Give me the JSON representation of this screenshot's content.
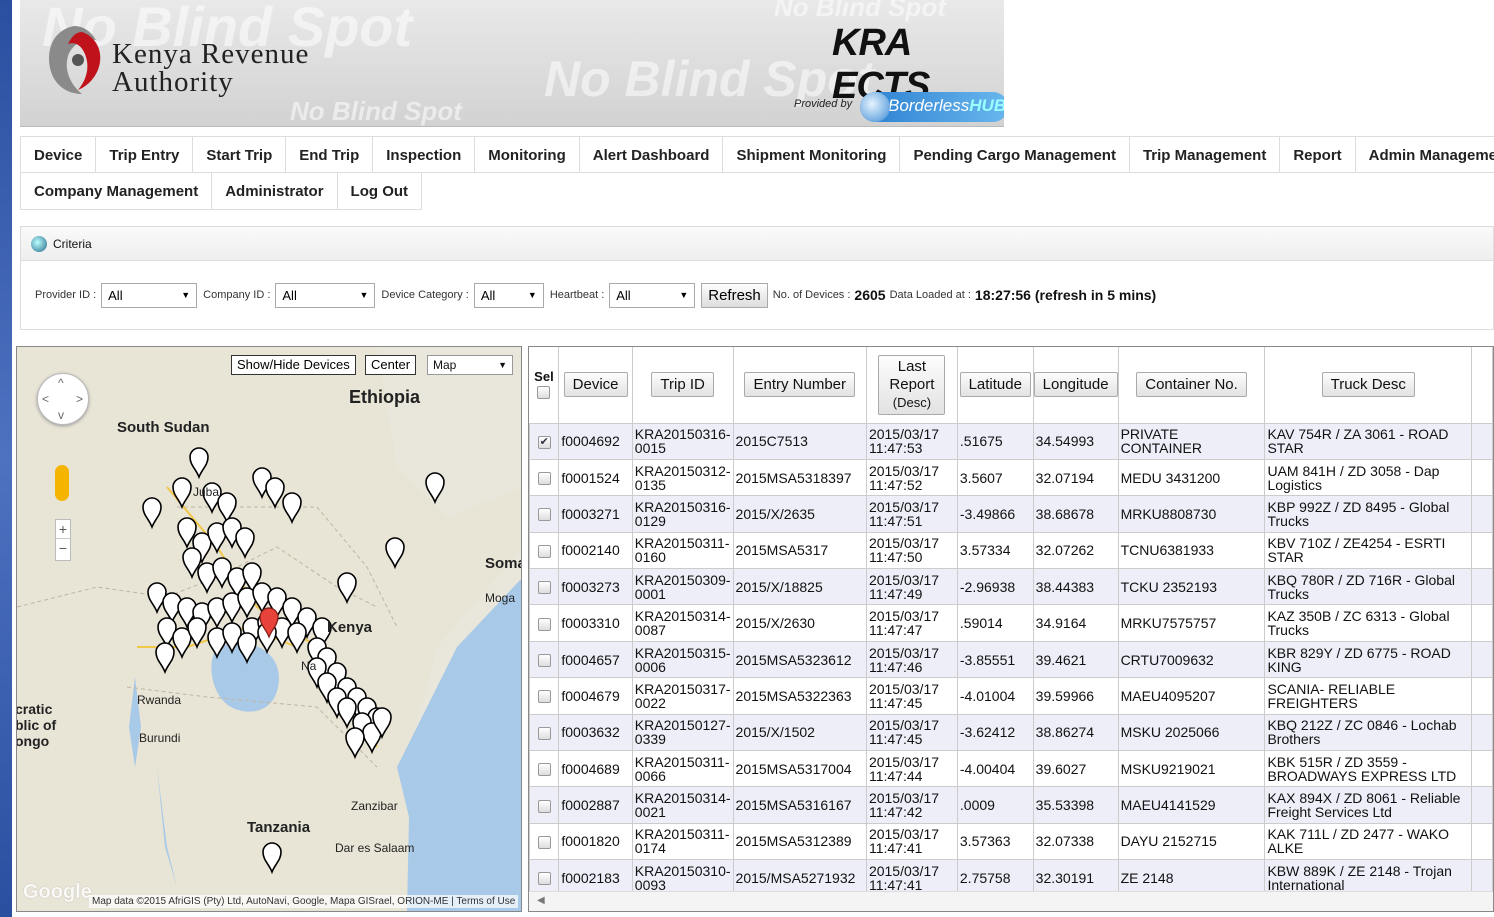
{
  "banner": {
    "brand_line1": "Kenya Revenue",
    "brand_line2": "Authority",
    "ghost_text": "No Blind Spot",
    "app_name": "KRA ECTS",
    "provided_by": "Provided by",
    "partner_name_a": "Borderless",
    "partner_name_b": "HUB"
  },
  "nav": {
    "row1": [
      "Device",
      "Trip Entry",
      "Start Trip",
      "End Trip",
      "Inspection",
      "Monitoring",
      "Alert Dashboard",
      "Shipment Monitoring",
      "Pending Cargo Management",
      "Trip Management",
      "Report",
      "Admin Management"
    ],
    "row2": [
      "Company Management",
      "Administrator",
      "Log Out"
    ]
  },
  "criteria": {
    "title": "Criteria",
    "provider_label": "Provider ID :",
    "provider_value": "All",
    "company_label": "Company ID :",
    "company_value": "All",
    "category_label": "Device Category :",
    "category_value": "All",
    "heartbeat_label": "Heartbeat :",
    "heartbeat_value": "All",
    "refresh_label": "Refresh",
    "devices_label": "No. of Devices :",
    "devices_count": "2605",
    "loaded_label": "Data Loaded at :",
    "loaded_value": "18:27:56 (refresh in 5 mins)"
  },
  "map": {
    "show_hide_label": "Show/Hide Devices",
    "center_label": "Center",
    "type_value": "Map",
    "labels": {
      "ethiopia": "Ethiopia",
      "south_sudan": "South Sudan",
      "juba": "Juba",
      "somalia": "Soma",
      "mogadishu": "Moga",
      "kenya": "Kenya",
      "nairobi": "Na",
      "rwanda": "Rwanda",
      "burundi": "Burundi",
      "drc1": "cratic",
      "drc2": "blic of",
      "drc3": "ongo",
      "tanzania": "Tanzania",
      "zanzibar": "Zanzibar",
      "dar": "Dar es Salaam",
      "google": "Google"
    },
    "attribution": "Map data ©2015 AfriGIS (Pty) Ltd, AutoNavi, Google, Mapa GISrael, ORION-ME",
    "terms": "Terms of Use"
  },
  "grid": {
    "headers": {
      "sel": "Sel",
      "device": "Device",
      "trip_id": "Trip ID",
      "entry": "Entry Number",
      "last_report1": "Last",
      "last_report2": "Report",
      "last_report_sort": "(Desc)",
      "lat": "Latitude",
      "lon": "Longitude",
      "container": "Container No.",
      "truck": "Truck Desc"
    },
    "rows": [
      {
        "checked": true,
        "device": "f0004692",
        "trip1": "KRA20150316-",
        "trip2": "0015",
        "entry": "2015C7513",
        "date": "2015/03/17",
        "time": "11:47:53",
        "lat": ".51675",
        "lon": "34.54993",
        "container": "PRIVATE CONTAINER",
        "truck": "KAV 754R / ZA 3061 - ROAD STAR"
      },
      {
        "checked": false,
        "device": "f0001524",
        "trip1": "KRA20150312-",
        "trip2": "0135",
        "entry": "2015MSA5318397",
        "date": "2015/03/17",
        "time": "11:47:52",
        "lat": "3.5607",
        "lon": "32.07194",
        "container": "MEDU 3431200",
        "truck": "UAM 841H / ZD 3058 - Dap Logistics"
      },
      {
        "checked": false,
        "device": "f0003271",
        "trip1": "KRA20150316-",
        "trip2": "0129",
        "entry": "2015/X/2635",
        "date": "2015/03/17",
        "time": "11:47:51",
        "lat": "-3.49866",
        "lon": "38.68678",
        "container": "MRKU8808730",
        "truck": "KBP 992Z / ZD 8495 - Global Trucks"
      },
      {
        "checked": false,
        "device": "f0002140",
        "trip1": "KRA20150311-",
        "trip2": "0160",
        "entry": "2015MSA5317",
        "date": "2015/03/17",
        "time": "11:47:50",
        "lat": "3.57334",
        "lon": "32.07262",
        "container": "TCNU6381933",
        "truck": "KBV 710Z / ZE4254 - ESRTI STAR"
      },
      {
        "checked": false,
        "device": "f0003273",
        "trip1": "KRA20150309-",
        "trip2": "0001",
        "entry": "2015/X/18825",
        "date": "2015/03/17",
        "time": "11:47:49",
        "lat": "-2.96938",
        "lon": "38.44383",
        "container": "TCKU 2352193",
        "truck": "KBQ 780R / ZD 716R - Global Trucks"
      },
      {
        "checked": false,
        "device": "f0003310",
        "trip1": "KRA20150314-",
        "trip2": "0087",
        "entry": "2015/X/2630",
        "date": "2015/03/17",
        "time": "11:47:47",
        "lat": ".59014",
        "lon": "34.9164",
        "container": "MRKU7575757",
        "truck": "KAZ 350B / ZC 6313 - Global Trucks"
      },
      {
        "checked": false,
        "device": "f0004657",
        "trip1": "KRA20150315-",
        "trip2": "0006",
        "entry": "2015MSA5323612",
        "date": "2015/03/17",
        "time": "11:47:46",
        "lat": "-3.85551",
        "lon": "39.4621",
        "container": "CRTU7009632",
        "truck": "KBR 829Y / ZD 6775 - ROAD KING"
      },
      {
        "checked": false,
        "device": "f0004679",
        "trip1": "KRA20150317-",
        "trip2": "0022",
        "entry": "2015MSA5322363",
        "date": "2015/03/17",
        "time": "11:47:45",
        "lat": "-4.01004",
        "lon": "39.59966",
        "container": "MAEU4095207",
        "truck": "SCANIA- RELIABLE FREIGHTERS"
      },
      {
        "checked": false,
        "device": "f0003632",
        "trip1": "KRA20150127-",
        "trip2": "0339",
        "entry": "2015/X/1502",
        "date": "2015/03/17",
        "time": "11:47:45",
        "lat": "-3.62412",
        "lon": "38.86274",
        "container": "MSKU 2025066",
        "truck": "KBQ 212Z / ZC 0846 - Lochab Brothers"
      },
      {
        "checked": false,
        "device": "f0004689",
        "trip1": "KRA20150311-",
        "trip2": "0066",
        "entry": "2015MSA5317004",
        "date": "2015/03/17",
        "time": "11:47:44",
        "lat": "-4.00404",
        "lon": "39.6027",
        "container": "MSKU9219021",
        "truck": "KBK 515R / ZD 3559 - BROADWAYS EXPRESS LTD"
      },
      {
        "checked": false,
        "device": "f0002887",
        "trip1": "KRA20150314-",
        "trip2": "0021",
        "entry": "2015MSA5316167",
        "date": "2015/03/17",
        "time": "11:47:42",
        "lat": ".0009",
        "lon": "35.53398",
        "container": "MAEU4141529",
        "truck": "KAX 894X / ZD 8061 - Reliable Freight Services Ltd"
      },
      {
        "checked": false,
        "device": "f0001820",
        "trip1": "KRA20150311-",
        "trip2": "0174",
        "entry": "2015MSA5312389",
        "date": "2015/03/17",
        "time": "11:47:41",
        "lat": "3.57363",
        "lon": "32.07338",
        "container": "DAYU 2152715",
        "truck": "KAK 711L / ZD 2477 - WAKO ALKE"
      },
      {
        "checked": false,
        "device": "f0002183",
        "trip1": "KRA20150310-",
        "trip2": "0093",
        "entry": "2015/MSA5271932",
        "date": "2015/03/17",
        "time": "11:47:41",
        "lat": "2.75758",
        "lon": "32.30191",
        "container": "ZE 2148",
        "truck": "KBW 889K / ZE 2148 - Trojan International"
      }
    ]
  }
}
